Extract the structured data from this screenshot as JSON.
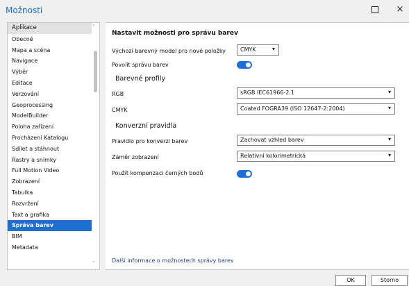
{
  "window": {
    "title": "Možnosti",
    "maximize_icon": "maximize-icon",
    "close_icon": "close-icon",
    "close_glyph": "×"
  },
  "sidebar": {
    "items": [
      {
        "label": "Aplikace"
      },
      {
        "label": "Obecné"
      },
      {
        "label": "Mapa a scéna"
      },
      {
        "label": "Navigace"
      },
      {
        "label": "Výběr"
      },
      {
        "label": "Editace"
      },
      {
        "label": "Verzování"
      },
      {
        "label": "Geoprocessing"
      },
      {
        "label": "ModelBuilder"
      },
      {
        "label": "Poloha zařízení"
      },
      {
        "label": "Procházení Katalogu"
      },
      {
        "label": "Sdílet a stáhnout"
      },
      {
        "label": "Rastry a snímky"
      },
      {
        "label": "Full Motion Video"
      },
      {
        "label": "Zobrazení"
      },
      {
        "label": "Tabulka"
      },
      {
        "label": "Rozvržení"
      },
      {
        "label": "Text a grafika"
      },
      {
        "label": "Správa barev",
        "selected": true
      },
      {
        "label": "BIM"
      },
      {
        "label": "Metadata"
      }
    ],
    "scroll_up_glyph": "˄",
    "scroll_down_glyph": "˅"
  },
  "main": {
    "heading": "Nastavit možnosti pro správu barev",
    "default_model_label": "Výchozí barevný model pro nové položky",
    "default_model_value": "CMYK",
    "enable_label": "Povolit správu barev",
    "enable_on": true,
    "profiles_heading": "Barevné profily",
    "rgb_label": "RGB",
    "rgb_value": "sRGB IEC61966-2.1",
    "cmyk_label": "CMYK",
    "cmyk_value": "Coated FOGRA39 (ISO 12647-2:2004)",
    "rules_heading": "Konverzní pravidla",
    "rule_label": "Pravidlo pro konverzi barev",
    "rule_value": "Zachovat vzhled barev",
    "intent_label": "Záměr zobrazení",
    "intent_value": "Relativní kolorimetrická",
    "black_point_label": "Použít kompenzaci černých bodů",
    "black_point_on": true,
    "more_info_link": "Další informace o možnostech správy barev",
    "dropdown_glyph": "▾"
  },
  "footer": {
    "ok_label": "OK",
    "cancel_label": "Storno"
  },
  "colors": {
    "accent": "#1f6fd0",
    "toggle_on": "#1e6fd9",
    "title": "#1a6fd1"
  }
}
